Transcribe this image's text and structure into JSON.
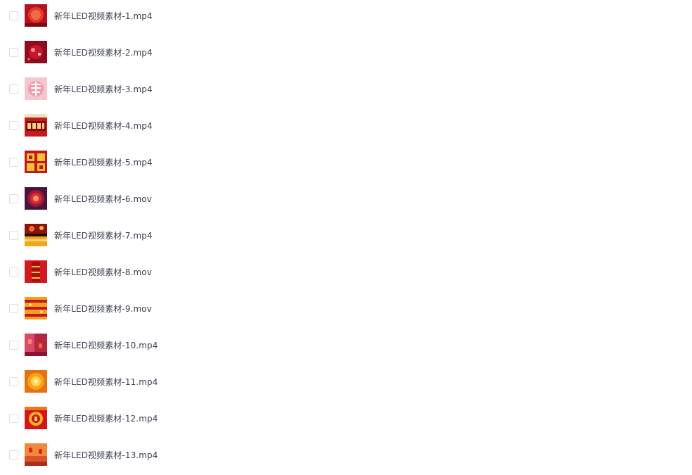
{
  "files": [
    {
      "name": "新年LED视频素材-1.mp4",
      "thumb": "red-lantern-orb-thumbnail"
    },
    {
      "name": "新年LED视频素材-2.mp4",
      "thumb": "red-firework-ball-thumbnail"
    },
    {
      "name": "新年LED视频素材-3.mp4",
      "thumb": "pink-chun-character-thumbnail"
    },
    {
      "name": "新年LED视频素材-4.mp4",
      "thumb": "red-new-year-banner-thumbnail"
    },
    {
      "name": "新年LED视频素材-5.mp4",
      "thumb": "gold-greeting-characters-thumbnail"
    },
    {
      "name": "新年LED视频素材-6.mov",
      "thumb": "purple-red-glow-orb-thumbnail"
    },
    {
      "name": "新年LED视频素材-7.mp4",
      "thumb": "fireworks-gold-stage-thumbnail"
    },
    {
      "name": "新年LED视频素材-8.mov",
      "thumb": "red-firecracker-thumbnail"
    },
    {
      "name": "新年LED视频素材-9.mov",
      "thumb": "yellow-red-pattern-thumbnail"
    },
    {
      "name": "新年LED视频素材-10.mp4",
      "thumb": "pink-red-lanterns-thumbnail"
    },
    {
      "name": "新年LED视频素材-11.mp4",
      "thumb": "orange-gold-burst-thumbnail"
    },
    {
      "name": "新年LED视频素材-12.mp4",
      "thumb": "fu-gold-coin-thumbnail"
    },
    {
      "name": "新年LED视频素材-13.mp4",
      "thumb": "orange-lantern-street-thumbnail"
    }
  ]
}
